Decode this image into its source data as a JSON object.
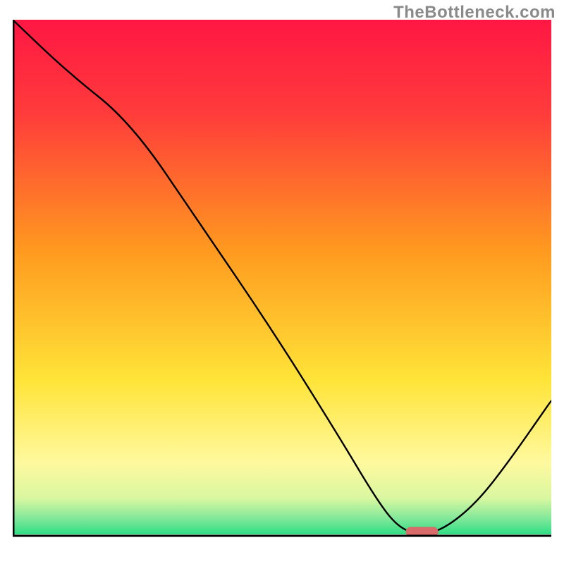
{
  "watermark": "TheBottleneck.com",
  "chart_data": {
    "type": "line",
    "title": "",
    "xlabel": "",
    "ylabel": "",
    "xlim": [
      0,
      100
    ],
    "ylim": [
      0,
      100
    ],
    "series": [
      {
        "name": "bottleneck-curve",
        "x": [
          0,
          10,
          22,
          35,
          48,
          60,
          68,
          72,
          76,
          80,
          86,
          92,
          100
        ],
        "y": [
          100,
          90,
          80,
          60,
          40,
          20,
          6,
          1,
          0,
          1,
          6,
          14,
          26
        ]
      }
    ],
    "marker": {
      "name": "optimal-point",
      "x": 76,
      "y": 0.5,
      "color": "#d96b6b"
    },
    "background_gradient": {
      "stops": [
        {
          "offset": 0,
          "color": "#ff1744"
        },
        {
          "offset": 18,
          "color": "#ff3b3b"
        },
        {
          "offset": 45,
          "color": "#ff9a1f"
        },
        {
          "offset": 70,
          "color": "#ffe438"
        },
        {
          "offset": 86,
          "color": "#fff99e"
        },
        {
          "offset": 93,
          "color": "#d9f7a0"
        },
        {
          "offset": 97,
          "color": "#7fe89a"
        },
        {
          "offset": 100,
          "color": "#2fdd84"
        }
      ]
    }
  }
}
